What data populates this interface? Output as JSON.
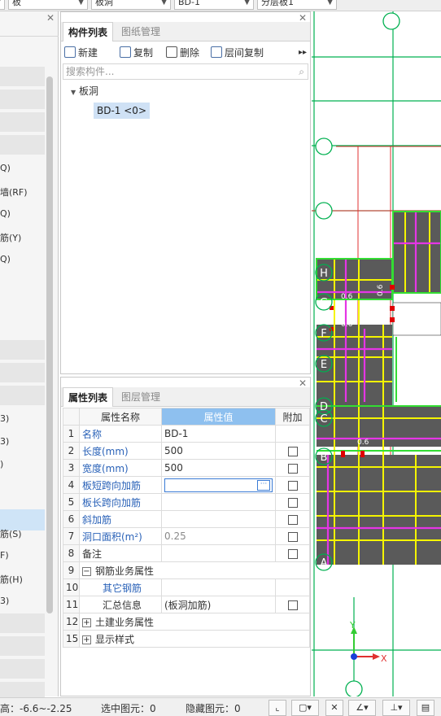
{
  "toolbar": {
    "dropdowns": [
      {
        "value": "板"
      },
      {
        "value": "板洞"
      },
      {
        "value": "BD-1"
      },
      {
        "value": "分层板1"
      }
    ]
  },
  "left_panel": {
    "items": [
      "Q)",
      "墙(RF)",
      "Q)",
      "筋(Y)",
      "Q)",
      "3)",
      "3)",
      ")",
      "筋(S)",
      "F)",
      "筋(H)",
      "3)"
    ]
  },
  "component_list": {
    "tabs": [
      "构件列表",
      "图纸管理"
    ],
    "toolbar": {
      "new_label": "新建",
      "copy_label": "复制",
      "delete_label": "删除",
      "layer_copy_label": "层间复制"
    },
    "search_placeholder": "搜索构件...",
    "tree": {
      "root_label": "板洞",
      "node_label": "BD-1 <0>"
    }
  },
  "properties": {
    "tabs": [
      "属性列表",
      "图层管理"
    ],
    "headers": {
      "name": "属性名称",
      "value": "属性值",
      "extra": "附加"
    },
    "rows": [
      {
        "num": "1",
        "name": "名称",
        "value": "BD-1"
      },
      {
        "num": "2",
        "name": "长度(mm)",
        "value": "500"
      },
      {
        "num": "3",
        "name": "宽度(mm)",
        "value": "500"
      },
      {
        "num": "4",
        "name": "板短跨向加筋",
        "value": ""
      },
      {
        "num": "5",
        "name": "板长跨向加筋",
        "value": ""
      },
      {
        "num": "6",
        "name": "斜加筋",
        "value": ""
      },
      {
        "num": "7",
        "name": "洞口面积(m²)",
        "value": "0.25"
      },
      {
        "num": "8",
        "name": "备注",
        "value": ""
      },
      {
        "num": "9",
        "name": "钢筋业务属性",
        "value": ""
      },
      {
        "num": "10",
        "name": "其它钢筋",
        "value": ""
      },
      {
        "num": "11",
        "name": "汇总信息",
        "value": "(板洞加筋)"
      },
      {
        "num": "12",
        "name": "土建业务属性",
        "value": ""
      },
      {
        "num": "15",
        "name": "显示样式",
        "value": ""
      }
    ],
    "edit_button": "···"
  },
  "canvas": {
    "axis_labels": [
      "H",
      "G",
      "F",
      "E",
      "D",
      "C",
      "B",
      "A"
    ],
    "dims": [
      "0.6",
      "0.6",
      "0.6",
      "0.6"
    ],
    "axis_x": "X",
    "axis_y": "Y"
  },
  "status": {
    "elevation": "标高：-6.6~-2.25",
    "selected": "选中图元：0",
    "hidden": "隐藏图元：0"
  },
  "colors": {
    "grid": "#00b050",
    "slab": "#5a5a5a",
    "rebar_yellow": "#f5f500",
    "rebar_magenta": "#e535e5",
    "accent_blue": "#3a7bd5"
  }
}
